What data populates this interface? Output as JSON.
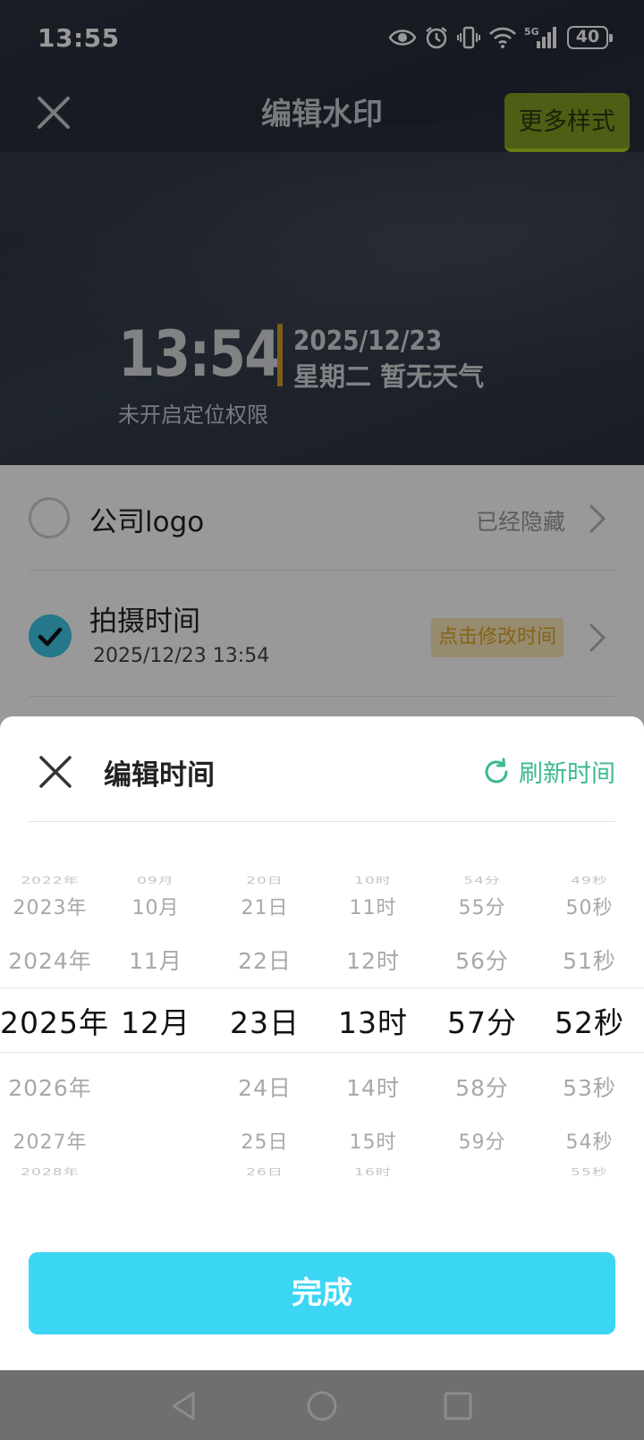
{
  "status_bar": {
    "time": "13:55",
    "battery": "40",
    "network": "5G"
  },
  "header": {
    "title": "编辑水印",
    "more_styles": "更多样式"
  },
  "watermark": {
    "time": "13:54",
    "date": "2025/12/23",
    "weekday_weather": "星期二  暂无天气",
    "location": "未开启定位权限",
    "accent_color": "#d39a2f"
  },
  "list": {
    "items": [
      {
        "label": "公司logo",
        "status": "已经隐藏",
        "checked": false
      },
      {
        "label": "拍摄时间",
        "sub": "2025/12/23 13:54",
        "action": "点击修改时间",
        "checked": true
      }
    ]
  },
  "sheet": {
    "title": "编辑时间",
    "refresh": "刷新时间",
    "done": "完成",
    "done_color": "#3cd6f5",
    "accent_color": "#3bb98d"
  },
  "picker": {
    "year": {
      "far_prev": "2022年",
      "prev2": "2023年",
      "prev1": "2024年",
      "selected": "2025年",
      "next1": "2026年",
      "next2": "2027年",
      "far_next": "2028年"
    },
    "month": {
      "far_prev": "09月",
      "prev2": "10月",
      "prev1": "11月",
      "selected": "12月",
      "next1": "",
      "next2": "",
      "far_next": ""
    },
    "day": {
      "far_prev": "20日",
      "prev2": "21日",
      "prev1": "22日",
      "selected": "23日",
      "next1": "24日",
      "next2": "25日",
      "far_next": "26日"
    },
    "hour": {
      "far_prev": "10时",
      "prev2": "11时",
      "prev1": "12时",
      "selected": "13时",
      "next1": "14时",
      "next2": "15时",
      "far_next": "16时"
    },
    "minute": {
      "far_prev": "54分",
      "prev2": "55分",
      "prev1": "56分",
      "selected": "57分",
      "next1": "58分",
      "next2": "59分",
      "far_next": ""
    },
    "second": {
      "far_prev": "49秒",
      "prev2": "50秒",
      "prev1": "51秒",
      "selected": "52秒",
      "next1": "53秒",
      "next2": "54秒",
      "far_next": "55秒"
    }
  }
}
